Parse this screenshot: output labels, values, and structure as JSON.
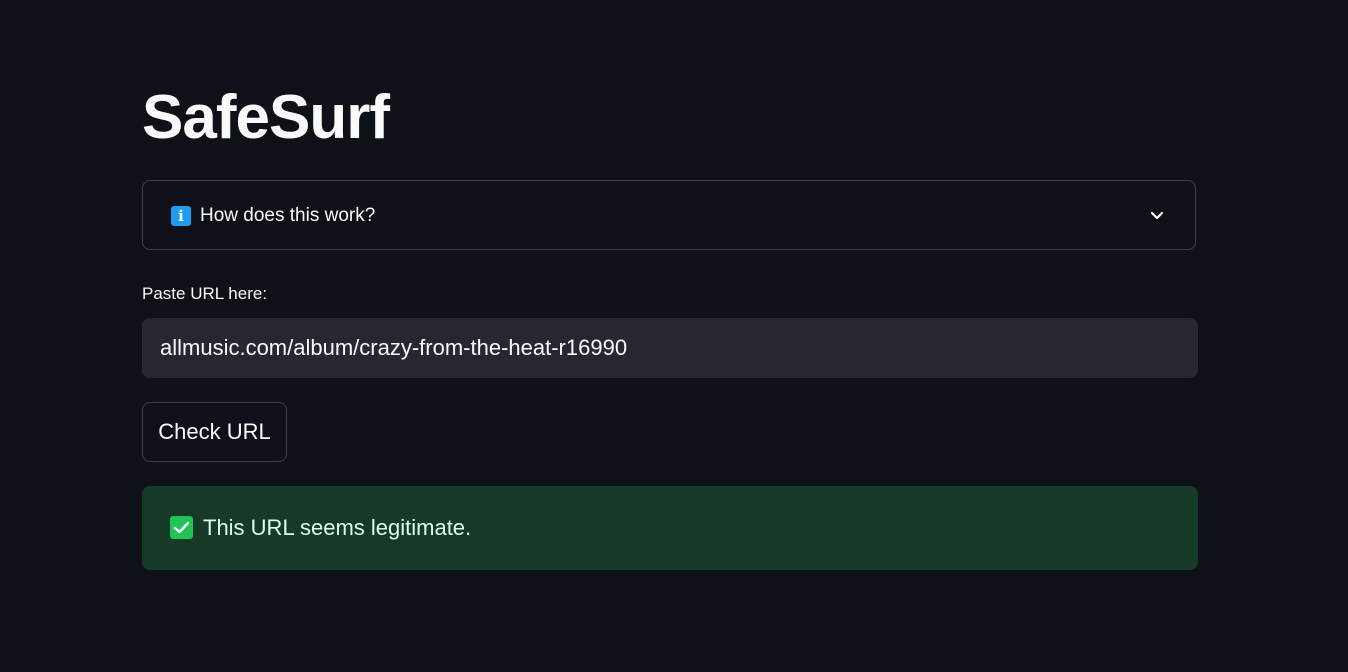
{
  "app": {
    "title": "SafeSurf"
  },
  "expander": {
    "icon": "info-icon",
    "icon_glyph": "i",
    "label": "How does this work?",
    "chevron": "chevron-down-icon"
  },
  "url_input": {
    "label": "Paste URL here:",
    "value": "allmusic.com/album/crazy-from-the-heat-r16990"
  },
  "check_button": {
    "label": "Check URL"
  },
  "result_alert": {
    "icon": "checkmark-icon",
    "message": "This URL seems legitimate."
  },
  "colors": {
    "background": "#0e1117",
    "input_background": "#262730",
    "success_background": "#173928",
    "success_icon": "#21c354",
    "info_icon": "#1f9cf0",
    "text": "#fafafa"
  }
}
